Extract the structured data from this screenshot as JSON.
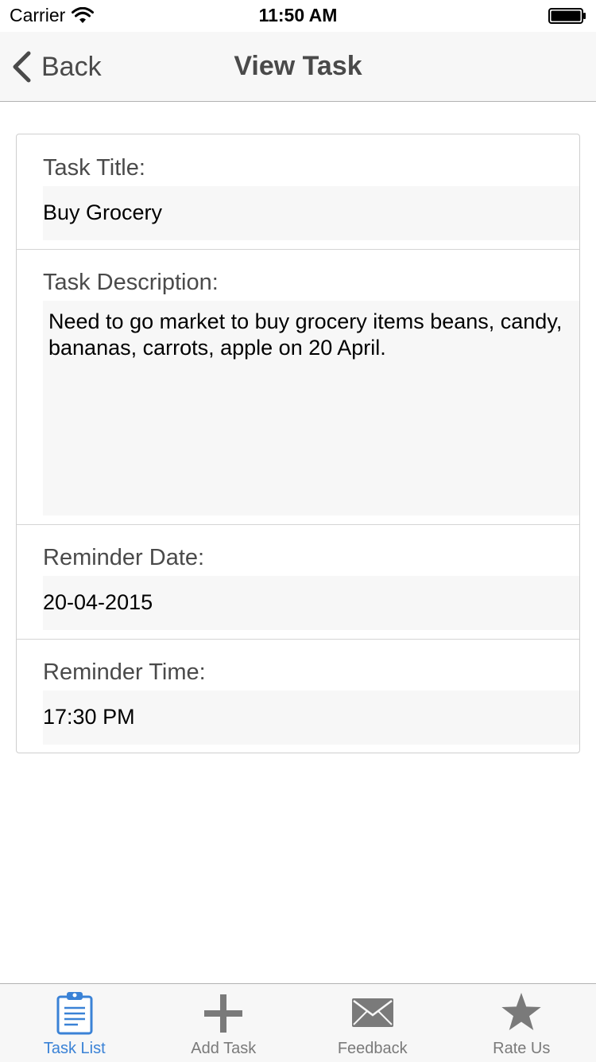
{
  "status_bar": {
    "carrier": "Carrier",
    "time": "11:50 AM"
  },
  "nav": {
    "back_label": "Back",
    "title": "View Task"
  },
  "task": {
    "title_label": "Task Title:",
    "title_value": "Buy Grocery",
    "description_label": "Task Description:",
    "description_value": "Need to go market to buy grocery items beans, candy, bananas, carrots, apple on 20 April.",
    "date_label": "Reminder Date:",
    "date_value": "20-04-2015",
    "time_label": "Reminder Time:",
    "time_value": "17:30 PM"
  },
  "tabs": [
    {
      "label": "Task List",
      "icon": "clipboard-icon",
      "active": true
    },
    {
      "label": "Add Task",
      "icon": "plus-icon",
      "active": false
    },
    {
      "label": "Feedback",
      "icon": "envelope-icon",
      "active": false
    },
    {
      "label": "Rate Us",
      "icon": "star-icon",
      "active": false
    }
  ],
  "colors": {
    "active_tab": "#3a82d6",
    "inactive_tab": "#7a7a7a",
    "nav_text": "#4a4a4a",
    "field_background": "#f7f7f7"
  }
}
